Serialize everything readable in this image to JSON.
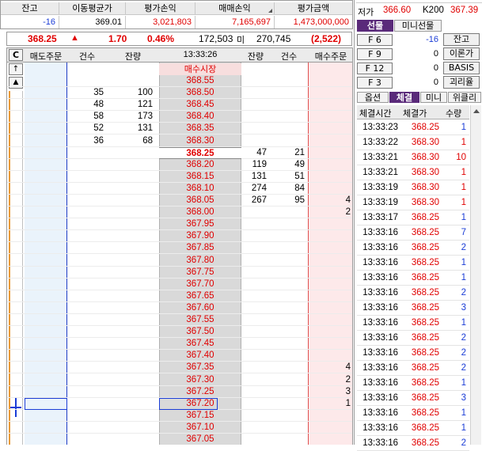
{
  "position": {
    "headers": [
      "잔고",
      "이동평균가",
      "평가손익",
      "매매손익",
      "평가금액"
    ],
    "values": [
      "-16",
      "369.01",
      "3,021,803",
      "7,165,697",
      "1,473,000,000"
    ]
  },
  "top_right": {
    "row2": {
      "label1": "저가",
      "value1": "366.60",
      "label2": "K200",
      "value2": "367.39"
    }
  },
  "summary": {
    "price": "368.25",
    "arrow": "▲",
    "change": "1.70",
    "pct": "0.46%",
    "sell_total": "172,503",
    "mid": "미",
    "buy_total": "270,745",
    "diff": "(2,522)"
  },
  "orderbook": {
    "headers": [
      "C",
      "매도주문",
      "건수",
      "잔량",
      "13:33:26",
      "잔량",
      "건수",
      "매수주문"
    ],
    "market_label": "매수시장",
    "rows": [
      {
        "price": "368.55"
      },
      {
        "price": "368.50",
        "sell_count": "35",
        "sell_qty": "100"
      },
      {
        "price": "368.45",
        "sell_count": "48",
        "sell_qty": "121"
      },
      {
        "price": "368.40",
        "sell_count": "58",
        "sell_qty": "173"
      },
      {
        "price": "368.35",
        "sell_count": "52",
        "sell_qty": "131"
      },
      {
        "price": "368.30",
        "sell_count": "36",
        "sell_qty": "68"
      },
      {
        "price": "368.25",
        "current": true,
        "buy_qty": "47",
        "buy_count": "21"
      },
      {
        "price": "368.20",
        "buy_qty": "119",
        "buy_count": "49"
      },
      {
        "price": "368.15",
        "buy_qty": "131",
        "buy_count": "51"
      },
      {
        "price": "368.10",
        "buy_qty": "274",
        "buy_count": "84"
      },
      {
        "price": "368.05",
        "buy_qty": "267",
        "buy_count": "95",
        "buy_order": "4"
      },
      {
        "price": "368.00",
        "buy_order": "2"
      },
      {
        "price": "367.95"
      },
      {
        "price": "367.90"
      },
      {
        "price": "367.85"
      },
      {
        "price": "367.80"
      },
      {
        "price": "367.75"
      },
      {
        "price": "367.70"
      },
      {
        "price": "367.65"
      },
      {
        "price": "367.60"
      },
      {
        "price": "367.55"
      },
      {
        "price": "367.50"
      },
      {
        "price": "367.45"
      },
      {
        "price": "367.40"
      },
      {
        "price": "367.35",
        "buy_order": "4"
      },
      {
        "price": "367.30",
        "buy_order": "2"
      },
      {
        "price": "367.25",
        "buy_order": "3"
      },
      {
        "price": "367.20",
        "buy_order": "1",
        "selected": true
      },
      {
        "price": "367.15"
      },
      {
        "price": "367.10"
      },
      {
        "price": "367.05"
      }
    ]
  },
  "side": {
    "tabs": [
      "선물",
      "미니선물"
    ],
    "fkeys": [
      {
        "key": "F 6",
        "value": "-16",
        "button": "잔고"
      },
      {
        "key": "F 9",
        "value": "0",
        "button": "이론가"
      },
      {
        "key": "F 12",
        "value": "0",
        "button": "BASIS"
      },
      {
        "key": "F 3",
        "value": "0",
        "button": "괴리율"
      }
    ],
    "subtabs": [
      "옵션",
      "체결",
      "미니",
      "위클리"
    ],
    "trade_headers": [
      "체결시간",
      "체결가",
      "수량"
    ],
    "trades": [
      {
        "time": "13:33:23",
        "price": "368.25",
        "qty": "1",
        "color": "blue"
      },
      {
        "time": "13:33:22",
        "price": "368.30",
        "qty": "1",
        "color": "red"
      },
      {
        "time": "13:33:21",
        "price": "368.30",
        "qty": "10",
        "color": "red"
      },
      {
        "time": "13:33:21",
        "price": "368.30",
        "qty": "1",
        "color": "red"
      },
      {
        "time": "13:33:19",
        "price": "368.30",
        "qty": "1",
        "color": "red"
      },
      {
        "time": "13:33:19",
        "price": "368.30",
        "qty": "1",
        "color": "red"
      },
      {
        "time": "13:33:17",
        "price": "368.25",
        "qty": "1",
        "color": "blue"
      },
      {
        "time": "13:33:16",
        "price": "368.25",
        "qty": "7",
        "color": "blue"
      },
      {
        "time": "13:33:16",
        "price": "368.25",
        "qty": "2",
        "color": "blue"
      },
      {
        "time": "13:33:16",
        "price": "368.25",
        "qty": "1",
        "color": "blue"
      },
      {
        "time": "13:33:16",
        "price": "368.25",
        "qty": "1",
        "color": "blue"
      },
      {
        "time": "13:33:16",
        "price": "368.25",
        "qty": "2",
        "color": "blue"
      },
      {
        "time": "13:33:16",
        "price": "368.25",
        "qty": "3",
        "color": "blue"
      },
      {
        "time": "13:33:16",
        "price": "368.25",
        "qty": "1",
        "color": "blue"
      },
      {
        "time": "13:33:16",
        "price": "368.25",
        "qty": "2",
        "color": "blue"
      },
      {
        "time": "13:33:16",
        "price": "368.25",
        "qty": "2",
        "color": "blue"
      },
      {
        "time": "13:33:16",
        "price": "368.25",
        "qty": "2",
        "color": "blue"
      },
      {
        "time": "13:33:16",
        "price": "368.25",
        "qty": "1",
        "color": "blue"
      },
      {
        "time": "13:33:16",
        "price": "368.25",
        "qty": "3",
        "color": "blue"
      },
      {
        "time": "13:33:16",
        "price": "368.25",
        "qty": "1",
        "color": "blue"
      },
      {
        "time": "13:33:16",
        "price": "368.25",
        "qty": "1",
        "color": "blue"
      },
      {
        "time": "13:33:16",
        "price": "368.25",
        "qty": "2",
        "color": "blue"
      }
    ]
  },
  "colors": {
    "ask_bg": "#eaf3fb",
    "bid_bg": "#fde9ea",
    "price_bg": "#d9d9d9",
    "current_price": "#e00000",
    "header_bg": "#ebebeb"
  }
}
